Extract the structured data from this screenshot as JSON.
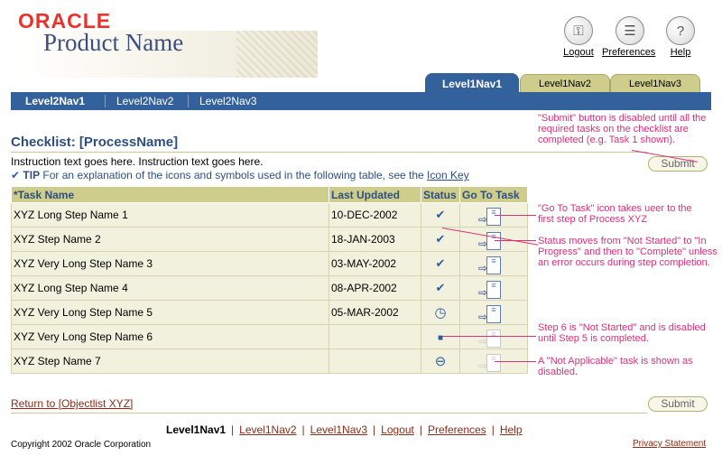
{
  "header": {
    "logo": "ORACLE",
    "product_name": "Product Name",
    "global_buttons": [
      {
        "label": "Logout",
        "icon": "logout-icon"
      },
      {
        "label": "Preferences",
        "icon": "preferences-icon"
      },
      {
        "label": "Help",
        "icon": "help-icon"
      }
    ]
  },
  "tabs": [
    "Level1Nav1",
    "Level1Nav2",
    "Level1Nav3"
  ],
  "subnav": [
    "Level2Nav1",
    "Level2Nav2",
    "Level2Nav3"
  ],
  "page": {
    "title": "Checklist: [ProcessName]",
    "instruction": "Instruction text goes here. Instruction text goes here.",
    "tip_label": "TIP",
    "tip_text": "For an explanation of the icons and symbols used in the following table, see the",
    "tip_link": "Icon Key",
    "submit_label": "Submit"
  },
  "table": {
    "headers": [
      "*Task Name",
      "Last Updated",
      "Status",
      "Go To Task"
    ],
    "rows": [
      {
        "name": "XYZ Long Step Name 1",
        "updated": "10-DEC-2002",
        "status": "✔"
      },
      {
        "name": "XYZ Step Name 2",
        "updated": "18-JAN-2003",
        "status": "✔"
      },
      {
        "name": "XYZ Very Long Step Name 3",
        "updated": "03-MAY-2002",
        "status": "✔"
      },
      {
        "name": "XYZ Long Step Name 4",
        "updated": "08-APR-2002",
        "status": "✔"
      },
      {
        "name": "XYZ Very Long Step Name 5",
        "updated": "05-MAR-2002",
        "status": "◷"
      },
      {
        "name": "XYZ Very Long Step Name 6",
        "updated": "",
        "status": "■"
      },
      {
        "name": "XYZ Step Name 7",
        "updated": "",
        "status": "⊖"
      }
    ]
  },
  "annotations": {
    "submit_note": "\"Submit\" button is disabled until all the required tasks on the checklist are completed (e.g. Task 1 shown).",
    "goto_note": "\"Go To Task\" icon  takes ueer to the first step of Process XYZ",
    "status_note": "Status moves from \"Not Started\" to \"In Progress\" and then to \"Complete\" unless an error occurs during step completion.",
    "step6_note": "Step 6 is \"Not Started\" and is disabled until Step 5 is completed.",
    "na_note": "A \"Not Applicable\" task is shown as disabled."
  },
  "footer": {
    "return_link": "Return to [Objectlist XYZ]",
    "nav": [
      "Level1Nav1",
      "Level1Nav2",
      "Level1Nav3",
      "Logout",
      "Preferences",
      "Help"
    ],
    "copyright": "Copyright 2002 Oracle Corporation",
    "privacy": "Privacy Statement"
  },
  "colors": {
    "brand_blue": "#33619b",
    "tab_khaki": "#cfcd8c",
    "annotation_pink": "#d9307a",
    "link_brown": "#8a2c17"
  }
}
